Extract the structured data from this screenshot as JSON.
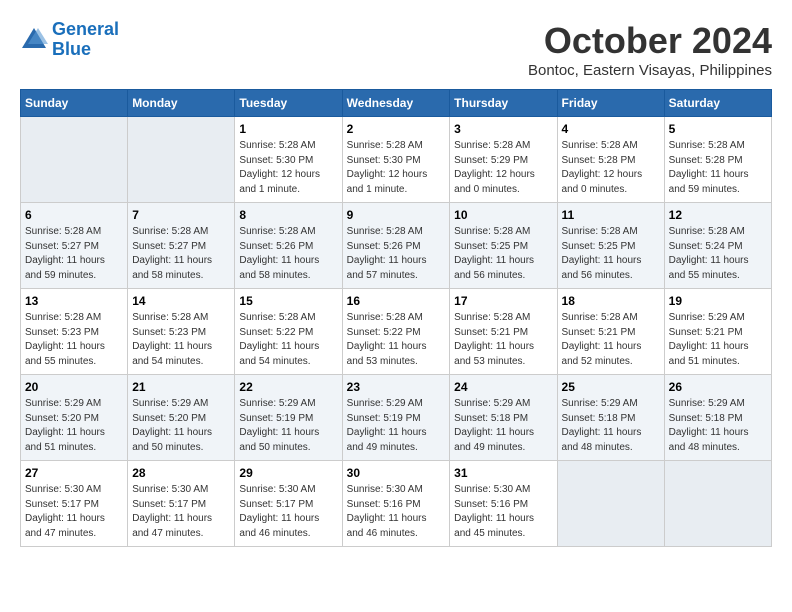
{
  "header": {
    "logo_line1": "General",
    "logo_line2": "Blue",
    "month": "October 2024",
    "location": "Bontoc, Eastern Visayas, Philippines"
  },
  "days_of_week": [
    "Sunday",
    "Monday",
    "Tuesday",
    "Wednesday",
    "Thursday",
    "Friday",
    "Saturday"
  ],
  "weeks": [
    [
      {
        "day": "",
        "info": ""
      },
      {
        "day": "",
        "info": ""
      },
      {
        "day": "1",
        "info": "Sunrise: 5:28 AM\nSunset: 5:30 PM\nDaylight: 12 hours\nand 1 minute."
      },
      {
        "day": "2",
        "info": "Sunrise: 5:28 AM\nSunset: 5:30 PM\nDaylight: 12 hours\nand 1 minute."
      },
      {
        "day": "3",
        "info": "Sunrise: 5:28 AM\nSunset: 5:29 PM\nDaylight: 12 hours\nand 0 minutes."
      },
      {
        "day": "4",
        "info": "Sunrise: 5:28 AM\nSunset: 5:28 PM\nDaylight: 12 hours\nand 0 minutes."
      },
      {
        "day": "5",
        "info": "Sunrise: 5:28 AM\nSunset: 5:28 PM\nDaylight: 11 hours\nand 59 minutes."
      }
    ],
    [
      {
        "day": "6",
        "info": "Sunrise: 5:28 AM\nSunset: 5:27 PM\nDaylight: 11 hours\nand 59 minutes."
      },
      {
        "day": "7",
        "info": "Sunrise: 5:28 AM\nSunset: 5:27 PM\nDaylight: 11 hours\nand 58 minutes."
      },
      {
        "day": "8",
        "info": "Sunrise: 5:28 AM\nSunset: 5:26 PM\nDaylight: 11 hours\nand 58 minutes."
      },
      {
        "day": "9",
        "info": "Sunrise: 5:28 AM\nSunset: 5:26 PM\nDaylight: 11 hours\nand 57 minutes."
      },
      {
        "day": "10",
        "info": "Sunrise: 5:28 AM\nSunset: 5:25 PM\nDaylight: 11 hours\nand 56 minutes."
      },
      {
        "day": "11",
        "info": "Sunrise: 5:28 AM\nSunset: 5:25 PM\nDaylight: 11 hours\nand 56 minutes."
      },
      {
        "day": "12",
        "info": "Sunrise: 5:28 AM\nSunset: 5:24 PM\nDaylight: 11 hours\nand 55 minutes."
      }
    ],
    [
      {
        "day": "13",
        "info": "Sunrise: 5:28 AM\nSunset: 5:23 PM\nDaylight: 11 hours\nand 55 minutes."
      },
      {
        "day": "14",
        "info": "Sunrise: 5:28 AM\nSunset: 5:23 PM\nDaylight: 11 hours\nand 54 minutes."
      },
      {
        "day": "15",
        "info": "Sunrise: 5:28 AM\nSunset: 5:22 PM\nDaylight: 11 hours\nand 54 minutes."
      },
      {
        "day": "16",
        "info": "Sunrise: 5:28 AM\nSunset: 5:22 PM\nDaylight: 11 hours\nand 53 minutes."
      },
      {
        "day": "17",
        "info": "Sunrise: 5:28 AM\nSunset: 5:21 PM\nDaylight: 11 hours\nand 53 minutes."
      },
      {
        "day": "18",
        "info": "Sunrise: 5:28 AM\nSunset: 5:21 PM\nDaylight: 11 hours\nand 52 minutes."
      },
      {
        "day": "19",
        "info": "Sunrise: 5:29 AM\nSunset: 5:21 PM\nDaylight: 11 hours\nand 51 minutes."
      }
    ],
    [
      {
        "day": "20",
        "info": "Sunrise: 5:29 AM\nSunset: 5:20 PM\nDaylight: 11 hours\nand 51 minutes."
      },
      {
        "day": "21",
        "info": "Sunrise: 5:29 AM\nSunset: 5:20 PM\nDaylight: 11 hours\nand 50 minutes."
      },
      {
        "day": "22",
        "info": "Sunrise: 5:29 AM\nSunset: 5:19 PM\nDaylight: 11 hours\nand 50 minutes."
      },
      {
        "day": "23",
        "info": "Sunrise: 5:29 AM\nSunset: 5:19 PM\nDaylight: 11 hours\nand 49 minutes."
      },
      {
        "day": "24",
        "info": "Sunrise: 5:29 AM\nSunset: 5:18 PM\nDaylight: 11 hours\nand 49 minutes."
      },
      {
        "day": "25",
        "info": "Sunrise: 5:29 AM\nSunset: 5:18 PM\nDaylight: 11 hours\nand 48 minutes."
      },
      {
        "day": "26",
        "info": "Sunrise: 5:29 AM\nSunset: 5:18 PM\nDaylight: 11 hours\nand 48 minutes."
      }
    ],
    [
      {
        "day": "27",
        "info": "Sunrise: 5:30 AM\nSunset: 5:17 PM\nDaylight: 11 hours\nand 47 minutes."
      },
      {
        "day": "28",
        "info": "Sunrise: 5:30 AM\nSunset: 5:17 PM\nDaylight: 11 hours\nand 47 minutes."
      },
      {
        "day": "29",
        "info": "Sunrise: 5:30 AM\nSunset: 5:17 PM\nDaylight: 11 hours\nand 46 minutes."
      },
      {
        "day": "30",
        "info": "Sunrise: 5:30 AM\nSunset: 5:16 PM\nDaylight: 11 hours\nand 46 minutes."
      },
      {
        "day": "31",
        "info": "Sunrise: 5:30 AM\nSunset: 5:16 PM\nDaylight: 11 hours\nand 45 minutes."
      },
      {
        "day": "",
        "info": ""
      },
      {
        "day": "",
        "info": ""
      }
    ]
  ]
}
